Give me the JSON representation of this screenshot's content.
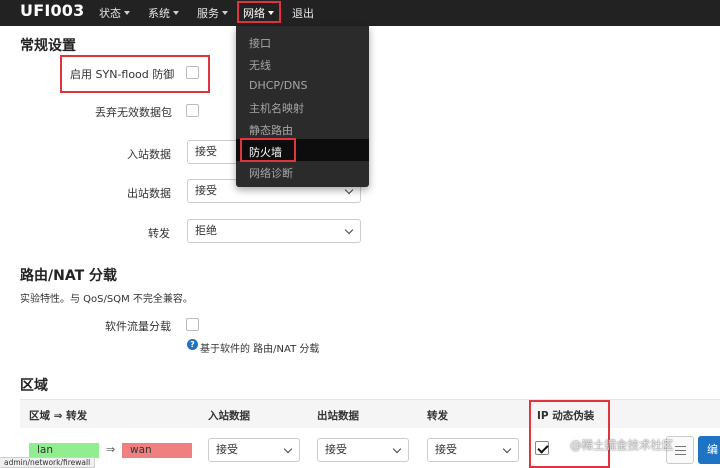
{
  "brand": "UFI003",
  "nav": {
    "status": "状态",
    "system": "系统",
    "services": "服务",
    "network": "网络",
    "logout": "退出"
  },
  "network_menu": {
    "items": [
      "接口",
      "无线",
      "DHCP/DNS",
      "主机名映射",
      "静态路由",
      "防火墙",
      "网络诊断"
    ],
    "active": "防火墙"
  },
  "general": {
    "title": "常规设置",
    "syn_flood_label": "启用 SYN-flood 防御",
    "drop_invalid_label": "丢弃无效数据包",
    "input_label": "入站数据",
    "input_value": "接受",
    "output_label": "出站数据",
    "output_value": "接受",
    "forward_label": "转发",
    "forward_value": "拒绝"
  },
  "offload": {
    "title": "路由/NAT 分载",
    "note": "实验特性。与 QoS/SQM 不完全兼容。",
    "sw_offload_label": "软件流量分载",
    "help_text": "基于软件的 路由/NAT 分载"
  },
  "zones": {
    "title": "区域",
    "headers": [
      "区域 ⇒ 转发",
      "入站数据",
      "出站数据",
      "转发",
      "IP 动态伪装"
    ],
    "row": {
      "from": "lan",
      "arrow": "⇒",
      "to": "wan",
      "input": "接受",
      "output": "接受",
      "forward": "接受",
      "masq_checked": true,
      "edit_label": "编"
    }
  },
  "colors": {
    "lan": "#90ee90",
    "wan": "#f08080",
    "highlight": "#e1333b",
    "primary": "#1f73c4"
  },
  "watermark": "@稀土掘金技术社区",
  "status_url": "admin/network/firewall"
}
